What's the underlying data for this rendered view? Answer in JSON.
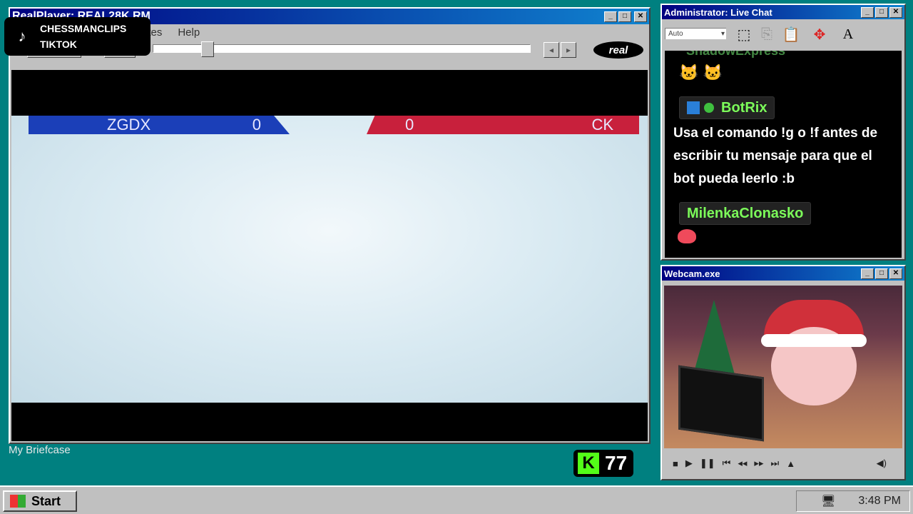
{
  "realplayer": {
    "title": "RealPlayer: REAL28K.RM",
    "menu": [
      "ites",
      "Help"
    ],
    "logo": "real",
    "scoreboard": {
      "left_team": "ZGDX",
      "left_score": "0",
      "right_team": "CK",
      "right_score": "0"
    }
  },
  "overlay": {
    "tiktok_line1": "CHESSMANCLIPS",
    "tiktok_line2": "TIKTOK",
    "kick_count": "77"
  },
  "desktop": {
    "briefcase_label": "My Briefcase"
  },
  "chat": {
    "title": "Administrator: Live Chat",
    "font_select": "Auto",
    "top_user": "ShadowExpress",
    "messages": [
      {
        "user": "BotRix",
        "text": "Usa el comando !g o !f antes de escribir tu mensaje para que el bot pueda leerlo :b"
      },
      {
        "user": "MilenkaClonasko"
      }
    ]
  },
  "webcam": {
    "title": "Webcam.exe"
  },
  "taskbar": {
    "start_label": "Start",
    "clock": "3:48 PM"
  },
  "colors": {
    "desktop": "#008080",
    "titlebar": "#000080",
    "team_left": "#1b3fb8",
    "team_right": "#c8203c",
    "chat_name": "#7CFC5A"
  }
}
